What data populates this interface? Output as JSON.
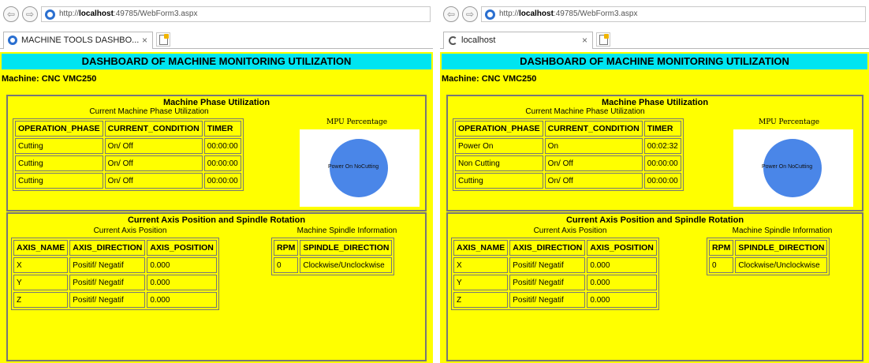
{
  "left": {
    "url_prefix": "http://",
    "url_host": "localhost",
    "url_rest": ":49785/WebForm3.aspx",
    "tab_title": "MACHINE TOOLS DASHBO...",
    "tab_close": "×",
    "page_title": "DASHBOARD OF MACHINE MONITORING UTILIZATION",
    "machine_label": "Machine: CNC VMC250",
    "phase": {
      "title": "Machine Phase Utilization",
      "subtitle": "Current Machine Phase Utilization",
      "headers": [
        "OPERATION_PHASE",
        "CURRENT_CONDITION",
        "TIMER"
      ],
      "rows": [
        [
          "Cutting",
          "On/ Off",
          "00:00:00"
        ],
        [
          "Cutting",
          "On/ Off",
          "00:00:00"
        ],
        [
          "Cutting",
          "On/ Off",
          "00:00:00"
        ]
      ],
      "chart_title": "MPU Percentage",
      "pie_labels": "Power On  NoCutting"
    },
    "axis": {
      "title": "Current Axis Position and Spindle Rotation",
      "subtitle": "Current Axis Position",
      "headers": [
        "AXIS_NAME",
        "AXIS_DIRECTION",
        "AXIS_POSITION"
      ],
      "rows": [
        [
          "X",
          "Positif/ Negatif",
          "0.000"
        ],
        [
          "Y",
          "Positif/ Negatif",
          "0.000"
        ],
        [
          "Z",
          "Positif/ Negatif",
          "0.000"
        ]
      ],
      "spindle_subtitle": "Machine Spindle Information",
      "spindle_headers": [
        "RPM",
        "SPINDLE_DIRECTION"
      ],
      "spindle_rows": [
        [
          "0",
          "Clockwise/Unclockwise"
        ]
      ]
    }
  },
  "right": {
    "url_prefix": "http://",
    "url_host": "localhost",
    "url_rest": ":49785/WebForm3.aspx",
    "tab_title": "localhost",
    "tab_close": "×",
    "page_title": "DASHBOARD OF MACHINE MONITORING UTILIZATION",
    "machine_label": "Machine: CNC VMC250",
    "phase": {
      "title": "Machine Phase Utilization",
      "subtitle": "Current Machine Phase Utilization",
      "headers": [
        "OPERATION_PHASE",
        "CURRENT_CONDITION",
        "TIMER"
      ],
      "rows": [
        [
          "Power On",
          "On",
          "00:02:32"
        ],
        [
          "Non Cutting",
          "On/ Off",
          "00:00:00"
        ],
        [
          "Cutting",
          "On/ Off",
          "00:00:00"
        ]
      ],
      "chart_title": "MPU Percentage",
      "pie_labels": "Power On  NoCutting"
    },
    "axis": {
      "title": "Current Axis Position and Spindle Rotation",
      "subtitle": "Current Axis Position",
      "headers": [
        "AXIS_NAME",
        "AXIS_DIRECTION",
        "AXIS_POSITION"
      ],
      "rows": [
        [
          "X",
          "Positif/ Negatif",
          "0.000"
        ],
        [
          "Y",
          "Positif/ Negatif",
          "0.000"
        ],
        [
          "Z",
          "Positif/ Negatif",
          "0.000"
        ]
      ],
      "spindle_subtitle": "Machine Spindle Information",
      "spindle_headers": [
        "RPM",
        "SPINDLE_DIRECTION"
      ],
      "spindle_rows": [
        [
          "0",
          "Clockwise/Unclockwise"
        ]
      ]
    }
  },
  "colors": {
    "page_bg": "#ffff00",
    "title_bg": "#00e5f0",
    "pie": "#4a86e8"
  },
  "icons": [
    "back-arrow-icon",
    "forward-arrow-icon",
    "ie-logo-icon",
    "loading-spinner-icon",
    "new-tab-icon",
    "close-icon"
  ]
}
